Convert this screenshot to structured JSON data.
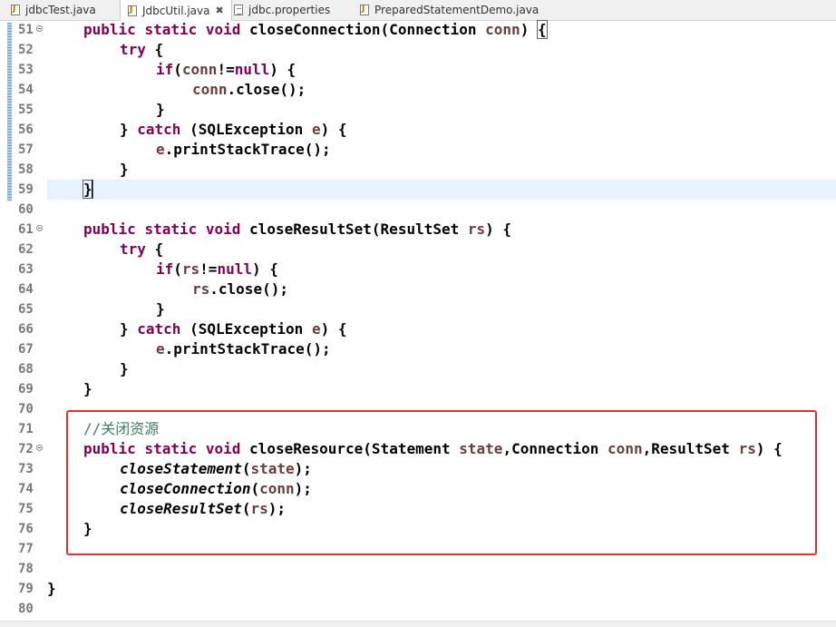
{
  "tabs": [
    {
      "label": "jdbcTest.java",
      "icon": "java-file-icon",
      "active": false
    },
    {
      "label": "JdbcUtil.java",
      "icon": "java-file-icon",
      "active": true,
      "close": "✖"
    },
    {
      "label": "jdbc.properties",
      "icon": "properties-file-icon",
      "active": false
    },
    {
      "label": "PreparedStatementDemo.java",
      "icon": "java-file-icon",
      "active": false
    }
  ],
  "editor": {
    "line_numbers": [
      "51",
      "52",
      "53",
      "54",
      "55",
      "56",
      "57",
      "58",
      "59",
      "60",
      "61",
      "62",
      "63",
      "64",
      "65",
      "66",
      "67",
      "68",
      "69",
      "70",
      "71",
      "72",
      "73",
      "74",
      "75",
      "76",
      "77",
      "78",
      "79",
      "80"
    ],
    "current_line": "59",
    "highlighted_block_lines": [
      "71",
      "72",
      "73",
      "74",
      "75",
      "76",
      "77"
    ],
    "tokens": {
      "public": "public",
      "static": "static",
      "void": "void",
      "try": "try",
      "if": "if",
      "null": "null",
      "catch": "catch",
      "m_closeConnection": "closeConnection",
      "m_closeResultSet": "closeResultSet",
      "m_closeResource": "closeResource",
      "m_closeStatement": "closeStatement",
      "m_close": "close",
      "m_printStackTrace": "printStackTrace",
      "t_Connection": "Connection",
      "t_ResultSet": "ResultSet",
      "t_SQLException": "SQLException",
      "t_Statement": "Statement",
      "v_conn": "conn",
      "v_rs": "rs",
      "v_e": "e",
      "v_state": "state",
      "comment": "//关闭资源"
    }
  },
  "colors": {
    "keyword": "#7f0055",
    "field": "#0000c0",
    "variable": "#6a3e3e",
    "comment": "#3f7f5f",
    "current_line": "#e8f2fe",
    "highlight_box": "#e03030"
  }
}
